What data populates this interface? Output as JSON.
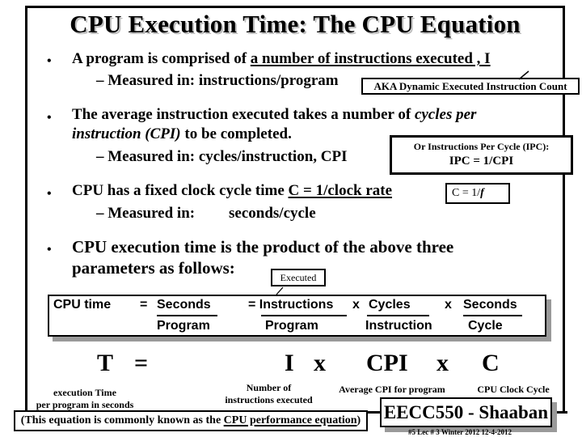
{
  "slide": {
    "title": "CPU Execution Time: The CPU Equation",
    "bullets": [
      {
        "prefix": "A program is comprised of ",
        "underlined": "a number of instructions executed ,  I",
        "sub": "– Measured in:  instructions/program",
        "callout": "AKA Dynamic Executed Instruction Count"
      },
      {
        "line1_prefix": "The average instruction executed takes a number of ",
        "line1_italic": "cycles per",
        "line2_italic": "instruction (CPI)",
        "line2_suffix": " to be completed.",
        "sub": "– Measured in:    cycles/instruction,  CPI",
        "callout_line1": "Or  Instructions Per Cycle (IPC):",
        "callout_line2": "IPC =  1/CPI"
      },
      {
        "prefix": "CPU has a fixed clock cycle time  ",
        "underlined": "C  = 1/clock rate",
        "sub_label": "– Measured in:",
        "sub_value": "seconds/cycle",
        "callout": "C   =  1/",
        "callout_italic": "f"
      },
      {
        "line1": "CPU execution time is the product of the above three",
        "line2": "parameters as follows:",
        "callout": "Executed"
      }
    ],
    "equation_box": {
      "lhs": "CPU time",
      "eq1": "=",
      "term1_num": "Seconds",
      "term1_den": "Program",
      "eq2": "= Instructions",
      "term2_den": "Program",
      "times1": "x",
      "term3_num": "Cycles",
      "term3_den": "Instruction",
      "times2": "x",
      "term4_num": "Seconds",
      "term4_den": "Cycle"
    },
    "big_equation": {
      "T": "T",
      "equals": "=",
      "I": "I",
      "x1": "x",
      "CPI": "CPI",
      "x2": "x",
      "C": "C",
      "label_T_line1": "execution Time",
      "label_T_line2": "per program in seconds",
      "label_I_line1": "Number of",
      "label_I_line2": "instructions executed",
      "label_CPI": "Average CPI for program",
      "label_C": "CPU Clock Cycle"
    },
    "footer": {
      "note_prefix": "(This equation is commonly known as the ",
      "note_underlined": "CPU performance equation",
      "note_suffix": ")",
      "brand": "EECC550 - Shaaban",
      "meta": "#5   Lec # 3    Winter 2012    12-4-2012"
    }
  }
}
